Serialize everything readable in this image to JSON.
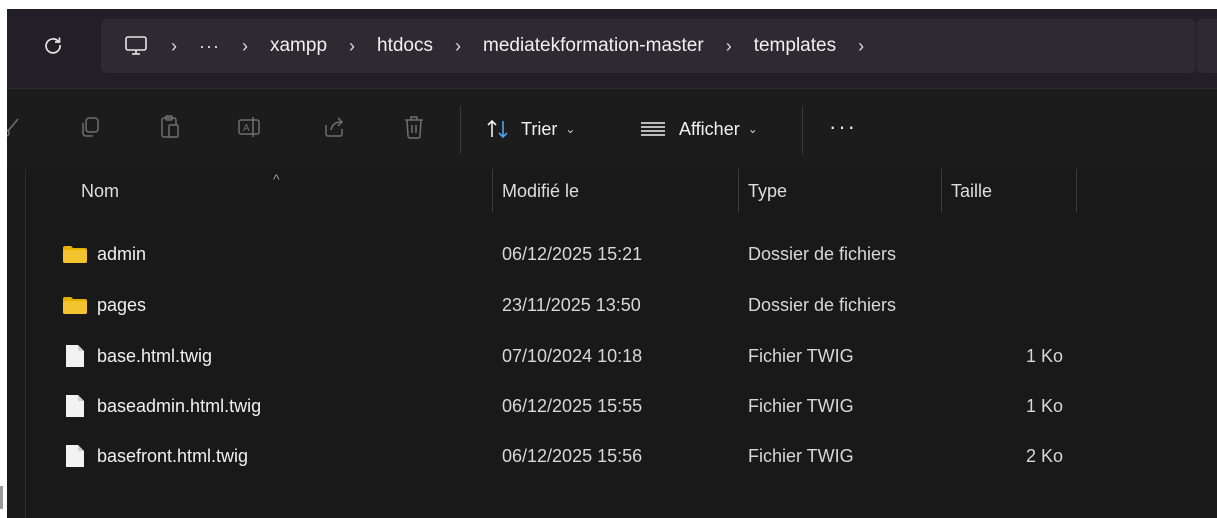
{
  "breadcrumb": {
    "more": "···",
    "items": [
      "xampp",
      "htdocs",
      "mediatekformation-master",
      "templates"
    ]
  },
  "toolbar": {
    "sort_label": "Trier",
    "view_label": "Afficher",
    "more_label": "···"
  },
  "columns": {
    "name": "Nom",
    "modified": "Modifié le",
    "type": "Type",
    "size": "Taille"
  },
  "files": [
    {
      "name": "admin",
      "modified": "06/12/2025 15:21",
      "type": "Dossier de fichiers",
      "size": "",
      "icon": "folder-icon"
    },
    {
      "name": "pages",
      "modified": "23/11/2025 13:50",
      "type": "Dossier de fichiers",
      "size": "",
      "icon": "folder-icon"
    },
    {
      "name": "base.html.twig",
      "modified": "07/10/2024 10:18",
      "type": "Fichier TWIG",
      "size": "1 Ko",
      "icon": "file-icon"
    },
    {
      "name": "baseadmin.html.twig",
      "modified": "06/12/2025 15:55",
      "type": "Fichier TWIG",
      "size": "1 Ko",
      "icon": "file-icon"
    },
    {
      "name": "basefront.html.twig",
      "modified": "06/12/2025 15:56",
      "type": "Fichier TWIG",
      "size": "2 Ko",
      "icon": "file-icon"
    }
  ],
  "colors": {
    "background": "#191919",
    "address_bar": "#2d2a31",
    "folder": "#f4c430",
    "text": "#f0f0f0"
  }
}
